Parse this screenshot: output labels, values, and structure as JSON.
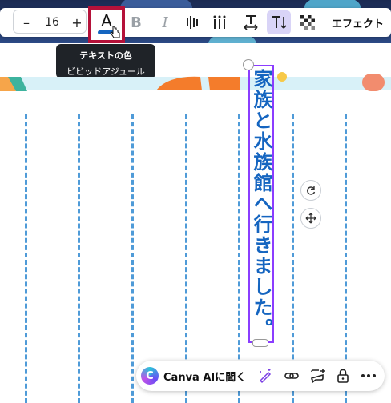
{
  "toolbar": {
    "font_size_decrease": "–",
    "font_size": "16",
    "font_size_increase": "+",
    "text_color_glyph": "A",
    "text_color_swatch": "#1565c0",
    "bold": "B",
    "italic": "I",
    "effects": "エフェクト"
  },
  "tooltip": {
    "title": "テキストの色",
    "subtitle": "ビビッドアジュール"
  },
  "canvas": {
    "vertical_text": "家族と水族館へ行きました。",
    "text_color": "#1565c0",
    "selection_color": "#8b3dff",
    "guide_color": "#4f9bd8"
  },
  "bottom_bar": {
    "ai_logo": "C",
    "ai_label": "Canva AIに聞く"
  },
  "colors": {
    "highlight": "#b5123a",
    "accent": "#8b3dff"
  }
}
